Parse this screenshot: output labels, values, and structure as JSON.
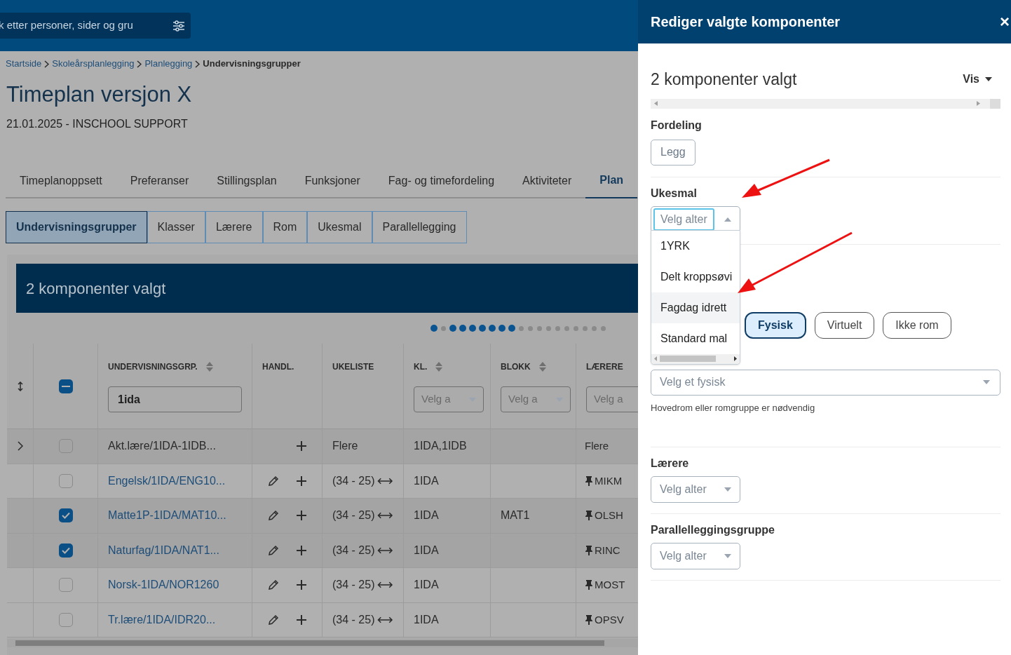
{
  "topbar": {
    "search_placeholder": "k etter personer, sider og gru"
  },
  "breadcrumbs": [
    {
      "label": "Startside",
      "current": false
    },
    {
      "label": "Skoleårsplanlegging",
      "current": false
    },
    {
      "label": "Planlegging",
      "current": false
    },
    {
      "label": "Undervisningsgrupper",
      "current": true
    }
  ],
  "page_title": "Timeplan versjon X",
  "subtitle": "21.01.2025 - INSCHOOL SUPPORT",
  "tabs": [
    {
      "label": "Timeplanoppsett",
      "selected": false
    },
    {
      "label": "Preferanser",
      "selected": false
    },
    {
      "label": "Stillingsplan",
      "selected": false
    },
    {
      "label": "Funksjoner",
      "selected": false
    },
    {
      "label": "Fag- og timefordeling",
      "selected": false
    },
    {
      "label": "Aktiviteter",
      "selected": false
    },
    {
      "label": "Plan",
      "selected": true
    }
  ],
  "subtabs": [
    {
      "label": "Undervisningsgrupper",
      "selected": true
    },
    {
      "label": "Klasser",
      "selected": false
    },
    {
      "label": "Lærere",
      "selected": false
    },
    {
      "label": "Rom",
      "selected": false
    },
    {
      "label": "Ukesmal",
      "selected": false
    },
    {
      "label": "Parallellegging",
      "selected": false
    }
  ],
  "selection_banner": "2 komponenter valgt",
  "dots": [
    {
      "active": true
    },
    {
      "active": false
    },
    {
      "active": true
    },
    {
      "active": true
    },
    {
      "active": true
    },
    {
      "active": true
    },
    {
      "active": true
    },
    {
      "active": true
    },
    {
      "active": true
    },
    {
      "active": false
    },
    {
      "active": false
    },
    {
      "active": false
    },
    {
      "active": false
    },
    {
      "active": false
    },
    {
      "active": false
    },
    {
      "active": false
    },
    {
      "active": false
    },
    {
      "active": false
    },
    {
      "active": false
    }
  ],
  "table": {
    "header_partial": true,
    "columns": [
      {
        "label": "UNDERVISNINGSGRP.",
        "sortable": true,
        "filter": {
          "kind": "input",
          "value": "1ida"
        }
      },
      {
        "label": "HANDL.",
        "sortable": false
      },
      {
        "label": "UKELISTE",
        "sortable": false
      },
      {
        "label": "KL.",
        "sortable": true,
        "filter": {
          "kind": "select",
          "placeholder": "Velg a"
        }
      },
      {
        "label": "BLOKK",
        "sortable": true,
        "filter": {
          "kind": "select",
          "placeholder": "Velg a"
        }
      },
      {
        "label": "LÆRERE",
        "sortable": false,
        "filter": {
          "kind": "select",
          "placeholder": "Velg a"
        }
      }
    ],
    "rows": [
      {
        "kind": "group",
        "checked": false,
        "name": "Akt.lære/1IDA-1IDB...",
        "ukeliste": "Flere",
        "kl": "1IDA,1IDB",
        "blokk": "",
        "laerere": "Flere"
      },
      {
        "kind": "item",
        "checked": false,
        "name": "Engelsk/1IDA/ENG10...",
        "ukeliste": "(34 - 25)",
        "kl": "1IDA",
        "blokk": "",
        "laerere": "MIKM"
      },
      {
        "kind": "item",
        "checked": true,
        "name": "Matte1P-1IDA/MAT10...",
        "ukeliste": "(34 - 25)",
        "kl": "1IDA",
        "blokk": "MAT1",
        "laerere": "OLSH"
      },
      {
        "kind": "item",
        "checked": true,
        "name": "Naturfag/1IDA/NAT1...",
        "ukeliste": "(34 - 25)",
        "kl": "1IDA",
        "blokk": "",
        "laerere": "RINC"
      },
      {
        "kind": "item",
        "checked": false,
        "name": "Norsk-1IDA/NOR1260",
        "ukeliste": "(34 - 25)",
        "kl": "1IDA",
        "blokk": "",
        "laerere": "MOST"
      },
      {
        "kind": "item",
        "checked": false,
        "name": "Tr.lære/1IDA/IDR20...",
        "ukeliste": "(34 - 25)",
        "kl": "1IDA",
        "blokk": "",
        "laerere": "OPSV"
      }
    ]
  },
  "panel": {
    "title": "Rediger valgte komponenter",
    "close": "×",
    "count": "2 komponenter valgt",
    "vis": "Vis",
    "fordeling": {
      "label": "Fordeling",
      "button": "Legg"
    },
    "ukesmal": {
      "label": "Ukesmal",
      "placeholder": "Velg alter",
      "expanded": true,
      "options": [
        {
          "label": "1YRK",
          "hovered": false
        },
        {
          "label": "Delt kroppsøvi",
          "hovered": false
        },
        {
          "label": "Fagdag idrett",
          "hovered": true
        },
        {
          "label": "Standard mal",
          "hovered": false
        }
      ]
    },
    "rom": {
      "types": [
        {
          "label": "Fysisk",
          "selected": true
        },
        {
          "label": "Virtuelt",
          "selected": false
        },
        {
          "label": "Ikke rom",
          "selected": false
        }
      ],
      "placeholder": "Velg et fysisk",
      "hint": "Hovedrom eller romgruppe er nødvendig"
    },
    "laerere": {
      "label": "Lærere",
      "placeholder": "Velg alter"
    },
    "parallell": {
      "label": "Parallelleggingsgruppe",
      "placeholder": "Velg alter"
    }
  }
}
